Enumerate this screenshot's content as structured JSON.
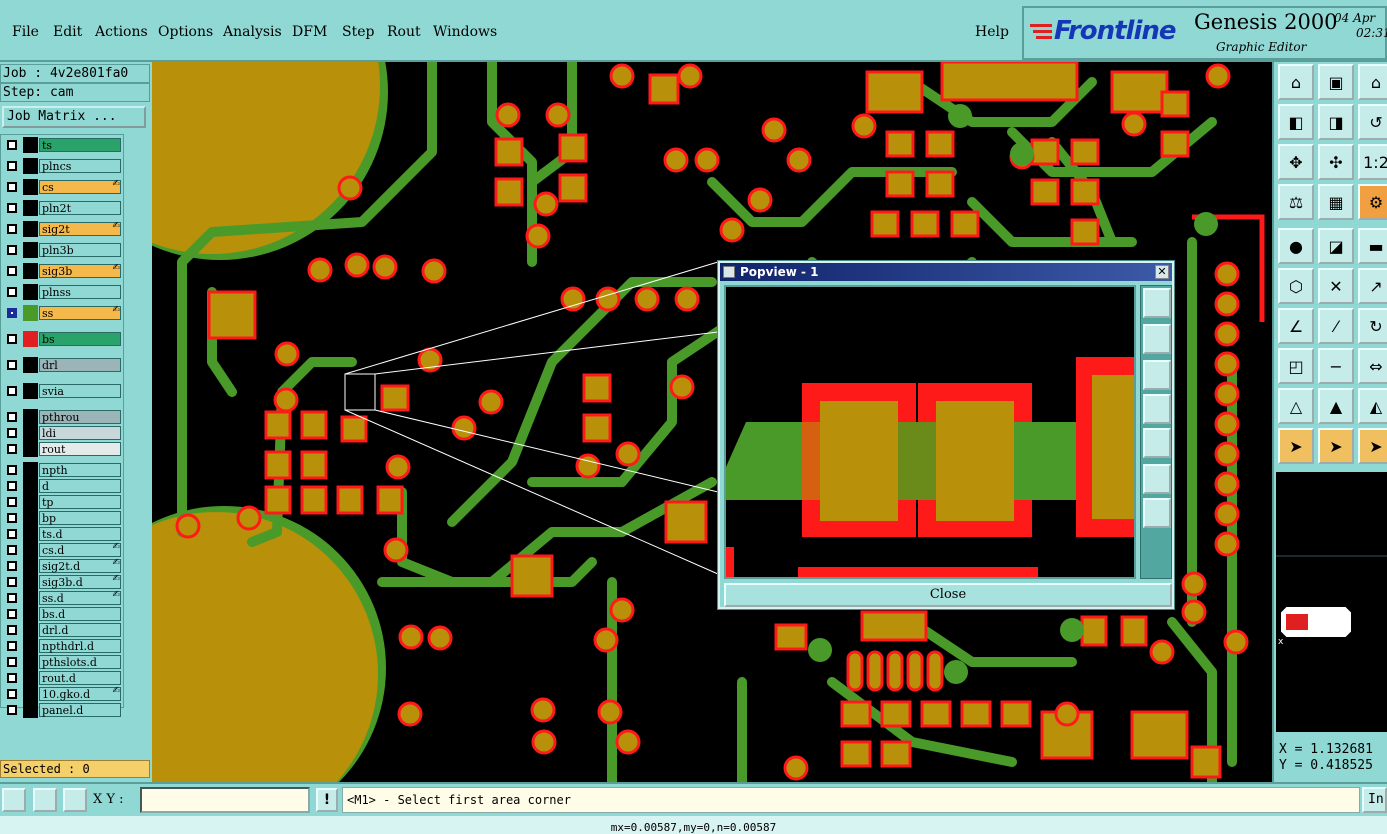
{
  "menu": {
    "items": [
      "File",
      "Edit",
      "Actions",
      "Options",
      "Analysis",
      "DFM",
      "Step",
      "Rout",
      "Windows"
    ],
    "help": "Help"
  },
  "brand": {
    "logo": "Frontline",
    "title": "Genesis 2000",
    "subtitle": "Graphic Editor",
    "date": "04 Apr",
    "time": "02:31"
  },
  "job": {
    "job_line": "Job : 4v2e801fa0",
    "step_line": "Step: cam",
    "matrix_button": "Job Matrix ..."
  },
  "layers": [
    {
      "name": "ts",
      "color": "#2aa36a",
      "checked": false
    },
    {
      "name": "plncs",
      "color": "#8fd8d4",
      "checked": false
    },
    {
      "name": "cs",
      "color": "#f5b84a",
      "checked": false,
      "mark": "edit"
    },
    {
      "name": "pln2t",
      "color": "#8fd8d4",
      "checked": false
    },
    {
      "name": "sig2t",
      "color": "#f5b84a",
      "checked": false,
      "mark": "edit"
    },
    {
      "name": "pln3b",
      "color": "#8fd8d4",
      "checked": false
    },
    {
      "name": "sig3b",
      "color": "#f5b84a",
      "checked": false,
      "mark": "edit"
    },
    {
      "name": "plnss",
      "color": "#8fd8d4",
      "checked": false
    },
    {
      "name": "ss",
      "color": "#f5b84a",
      "checked": true,
      "swatch": "#4a9a2a",
      "mark": "edit"
    },
    {
      "name": "bs",
      "color": "#2aa36a",
      "checked": false,
      "swatch": "#e02020"
    },
    {
      "name": "drl",
      "color": "#9ab4b8",
      "checked": false
    },
    {
      "name": "svia",
      "color": "#8fd8d4",
      "checked": false
    },
    {
      "name": "pthrou",
      "color": "#9ab4b8",
      "checked": false
    },
    {
      "name": "ldi",
      "color": "#c8d8da",
      "checked": false
    },
    {
      "name": "rout",
      "color": "#e4eaea",
      "checked": false
    },
    {
      "name": "npth",
      "color": "#8fd8d4",
      "checked": false
    },
    {
      "name": "d",
      "color": "#8fd8d4",
      "checked": false
    },
    {
      "name": "tp",
      "color": "#8fd8d4",
      "checked": false
    },
    {
      "name": "bp",
      "color": "#8fd8d4",
      "checked": false
    },
    {
      "name": "ts.d",
      "color": "#8fd8d4",
      "checked": false
    },
    {
      "name": "cs.d",
      "color": "#8fd8d4",
      "checked": false,
      "mark": "edit"
    },
    {
      "name": "sig2t.d",
      "color": "#8fd8d4",
      "checked": false,
      "mark": "edit"
    },
    {
      "name": "sig3b.d",
      "color": "#8fd8d4",
      "checked": false,
      "mark": "edit"
    },
    {
      "name": "ss.d",
      "color": "#8fd8d4",
      "checked": false,
      "mark": "edit"
    },
    {
      "name": "bs.d",
      "color": "#8fd8d4",
      "checked": false
    },
    {
      "name": "drl.d",
      "color": "#8fd8d4",
      "checked": false
    },
    {
      "name": "npthdrl.d",
      "color": "#8fd8d4",
      "checked": false
    },
    {
      "name": "pthslots.d",
      "color": "#8fd8d4",
      "checked": false
    },
    {
      "name": "rout.d",
      "color": "#8fd8d4",
      "checked": false
    },
    {
      "name": "10.gko.d",
      "color": "#8fd8d4",
      "checked": false,
      "mark": "edit"
    },
    {
      "name": "panel.d",
      "color": "#8fd8d4",
      "checked": false
    }
  ],
  "selected": "Selected : 0",
  "popview": {
    "title": "Popview - 1",
    "close_label": "Close"
  },
  "coords": {
    "x": "X = 1.132681",
    "y": "Y = 0.418525"
  },
  "bottom": {
    "xy_label": "X Y :",
    "xy_value": "",
    "warn": "!",
    "prompt": "<M1> - Select first area corner",
    "in_button": "In"
  },
  "status": "mx=0.00587,my=0,n=0.00587",
  "colors": {
    "pad": "#b8900a",
    "copper": "#4a9a2a",
    "outline": "#ff1a1a",
    "ui": "#8fd8d4"
  }
}
